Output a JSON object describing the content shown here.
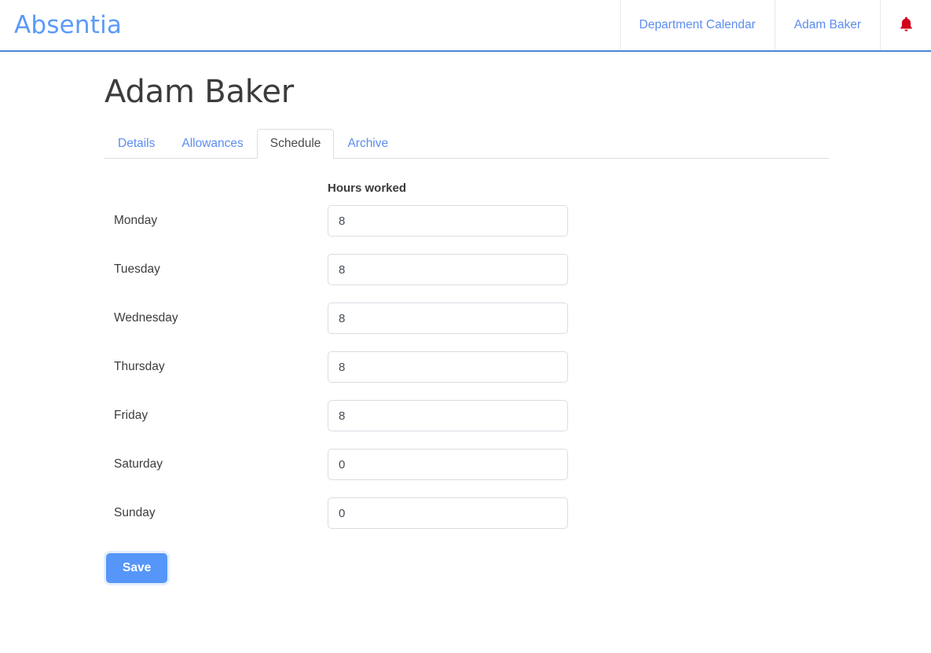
{
  "navbar": {
    "brand": "Absentia",
    "items": [
      {
        "label": "Department Calendar",
        "name": "nav-department-calendar"
      },
      {
        "label": "Adam Baker",
        "name": "nav-user-adam-baker"
      }
    ],
    "notification_icon": "bell-icon",
    "notification_glyph": "🔔",
    "notification_color": "#d0021b",
    "border_color": "#4a86d8",
    "brand_color": "#5b9bf8",
    "link_color": "#5b8def"
  },
  "page": {
    "title": "Adam Baker"
  },
  "tabs": [
    {
      "label": "Details",
      "active": false
    },
    {
      "label": "Allowances",
      "active": false
    },
    {
      "label": "Schedule",
      "active": true
    },
    {
      "label": "Archive",
      "active": false
    }
  ],
  "schedule": {
    "column_header": "Hours worked",
    "rows": [
      {
        "day": "Monday",
        "hours": "8"
      },
      {
        "day": "Tuesday",
        "hours": "8"
      },
      {
        "day": "Wednesday",
        "hours": "8"
      },
      {
        "day": "Thursday",
        "hours": "8"
      },
      {
        "day": "Friday",
        "hours": "8"
      },
      {
        "day": "Saturday",
        "hours": "0"
      },
      {
        "day": "Sunday",
        "hours": "0"
      }
    ]
  },
  "actions": {
    "save_label": "Save",
    "save_color": "#5596f8"
  }
}
